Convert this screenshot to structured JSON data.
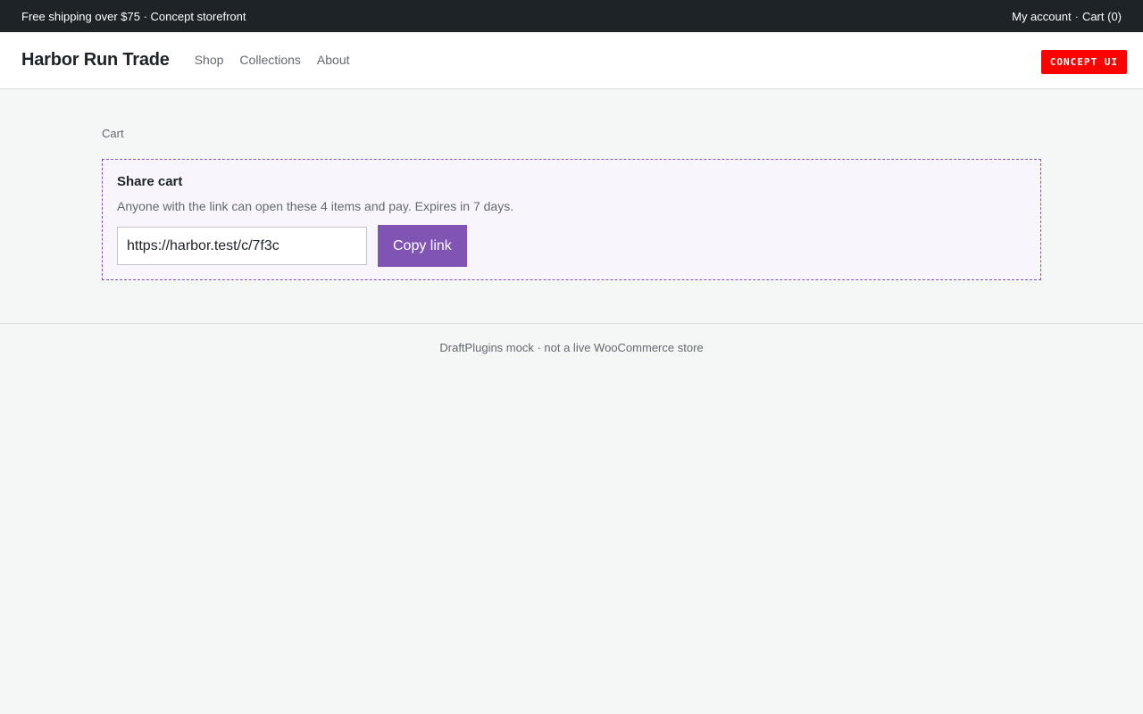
{
  "topbar": {
    "promo": "Free shipping over $75 · Concept storefront",
    "account_link": "My account",
    "separator": "·",
    "cart_link": "Cart (0)"
  },
  "header": {
    "brand": "Harbor Run Trade",
    "nav": [
      {
        "label": "Shop"
      },
      {
        "label": "Collections"
      },
      {
        "label": "About"
      }
    ],
    "badge": "CONCEPT UI"
  },
  "main": {
    "breadcrumb": "Cart",
    "share": {
      "title": "Share cart",
      "description": "Anyone with the link can open these 4 items and pay. Expires in 7 days.",
      "link_value": "https://harbor.test/c/7f3c",
      "copy_label": "Copy link"
    }
  },
  "footer": {
    "text": "DraftPlugins mock · not a live WooCommerce store"
  },
  "colors": {
    "topbar_bg": "#1d2327",
    "accent": "#7f54b3",
    "badge_bg": "#ff0000",
    "page_bg": "#f5f6f6"
  }
}
